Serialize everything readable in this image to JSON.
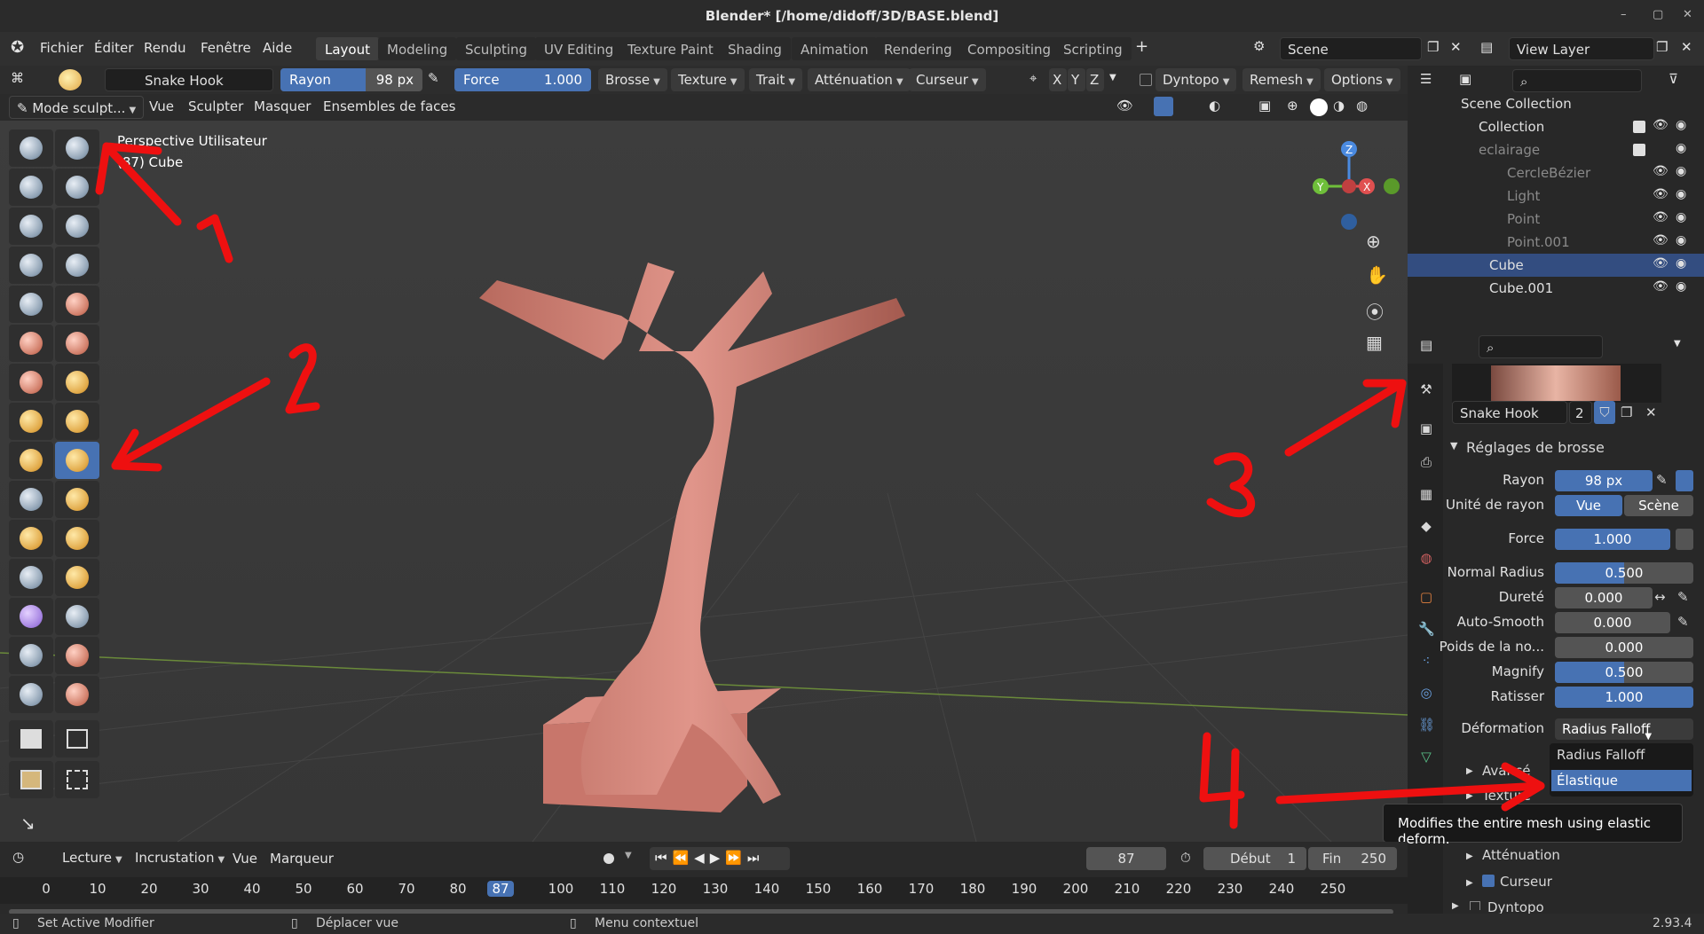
{
  "title": "Blender* [/home/didoff/3D/BASE.blend]",
  "menus": [
    "Fichier",
    "Éditer",
    "Rendu",
    "Fenêtre",
    "Aide"
  ],
  "workspaces": [
    "Layout",
    "Modeling",
    "Sculpting",
    "UV Editing",
    "Texture Paint",
    "Shading",
    "Animation",
    "Rendering",
    "Compositing",
    "Scripting"
  ],
  "scene": "Scene",
  "view_layer": "View Layer",
  "tool_header": {
    "brush_name": "Snake Hook",
    "radius_label": "Rayon",
    "radius_value": "98 px",
    "force_label": "Force",
    "force_value": "1.000",
    "menus": [
      "Brosse",
      "Texture",
      "Trait",
      "Atténuation",
      "Curseur"
    ],
    "axes": [
      "X",
      "Y",
      "Z"
    ],
    "right_menus": [
      "Dyntopo",
      "Remesh",
      "Options"
    ]
  },
  "mode_header": {
    "mode": "Mode sculpt...",
    "items": [
      "Vue",
      "Sculpter",
      "Masquer",
      "Ensembles de faces"
    ]
  },
  "viewport": {
    "line1": "Perspective Utilisateur",
    "line2": "(87) Cube",
    "gizmo": {
      "z": "Z",
      "y": "Y",
      "x": "X"
    }
  },
  "annotations": [
    "1",
    "2",
    "3",
    "4"
  ],
  "outliner": {
    "rows": [
      {
        "label": "Scene Collection"
      },
      {
        "label": "Collection"
      },
      {
        "label": "eclairage"
      },
      {
        "label": "CercleBézier"
      },
      {
        "label": "Light"
      },
      {
        "label": "Point"
      },
      {
        "label": "Point.001"
      },
      {
        "label": "Cube"
      },
      {
        "label": "Cube.001"
      }
    ]
  },
  "properties": {
    "brush_name": "Snake Hook",
    "user_count": "2",
    "section": "Réglages de brosse",
    "rows": [
      {
        "label": "Rayon",
        "value": "98 px",
        "fill": 0.3
      },
      {
        "label": "Unité de rayon",
        "value": "Vue",
        "alt": "Scène"
      },
      {
        "label": "Force",
        "value": "1.000",
        "fill": 1.0
      },
      {
        "label": "Normal Radius",
        "value": "0.500",
        "fill": 0.5
      },
      {
        "label": "Dureté",
        "value": "0.000",
        "fill": 0.0
      },
      {
        "label": "Auto-Smooth",
        "value": "0.000",
        "fill": 0.0
      },
      {
        "label": "Poids de la no...",
        "value": "0.000",
        "fill": 0.0
      },
      {
        "label": "Magnify",
        "value": "0.500",
        "fill": 0.5
      },
      {
        "label": "Ratisser",
        "value": "1.000",
        "fill": 1.0
      }
    ],
    "deformation_label": "Déformation",
    "deformation_value": "Radius Falloff",
    "dropdown_options": [
      "Radius Falloff",
      "Élastique"
    ],
    "subpanels": [
      "Avancé",
      "Texture",
      "Atténuation",
      "Curseur",
      "Dyntopo"
    ],
    "tooltip": "Modifies the entire mesh using elastic deform."
  },
  "timeline": {
    "menus": [
      "Lecture",
      "Incrustation",
      "Vue",
      "Marqueur"
    ],
    "current_frame": "87",
    "start_label": "Début",
    "start_value": "1",
    "end_label": "Fin",
    "end_value": "250",
    "ticks": [
      "0",
      "10",
      "20",
      "30",
      "40",
      "50",
      "60",
      "70",
      "80",
      "87",
      "100",
      "110",
      "120",
      "130",
      "140",
      "150",
      "160",
      "170",
      "180",
      "190",
      "200",
      "210",
      "220",
      "230",
      "240",
      "250"
    ]
  },
  "statusbar": {
    "left": "Set Active Modifier",
    "mid": "Déplacer vue",
    "right": "Menu contextuel",
    "version": "2.93.4"
  },
  "colors": {
    "accent": "#4772b3",
    "annotation": "#ee1010",
    "mesh": "#d48479"
  }
}
